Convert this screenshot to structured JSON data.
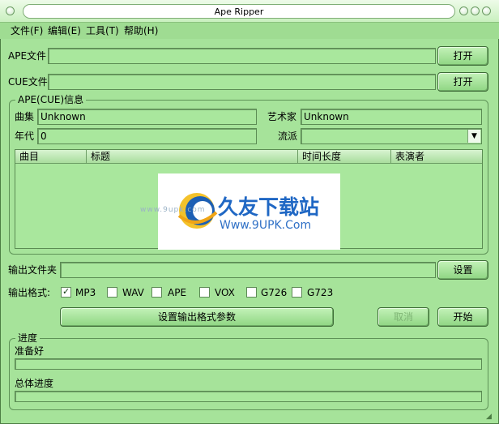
{
  "window": {
    "title": "Ape Ripper"
  },
  "menu": [
    {
      "label": "文件(F)"
    },
    {
      "label": "编辑(E)"
    },
    {
      "label": "工具(T)"
    },
    {
      "label": "帮助(H)"
    }
  ],
  "ape_file": {
    "label": "APE文件",
    "value": "",
    "open_label": "打开"
  },
  "cue_file": {
    "label": "CUE文件",
    "value": "",
    "open_label": "打开"
  },
  "info_group": {
    "title": "APE(CUE)信息",
    "album_label": "曲集",
    "album_value": "Unknown",
    "artist_label": "艺术家",
    "artist_value": "Unknown",
    "year_label": "年代",
    "year_value": "0",
    "genre_label": "流派",
    "genre_value": ""
  },
  "track_list": {
    "columns": [
      "曲目",
      "标题",
      "时间长度",
      "表演者"
    ],
    "rows": []
  },
  "watermark": {
    "brand": "久友下载站",
    "url": "Www.9UPK.Com",
    "small": "www.9upk.com"
  },
  "output": {
    "label": "输出文件夹",
    "value": "",
    "settings_label": "设置"
  },
  "format": {
    "label": "输出格式:",
    "options": [
      {
        "label": "MP3",
        "checked": true
      },
      {
        "label": "WAV",
        "checked": false
      },
      {
        "label": "APE",
        "checked": false
      },
      {
        "label": "VOX",
        "checked": false
      },
      {
        "label": "G726",
        "checked": false
      },
      {
        "label": "G723",
        "checked": false
      }
    ]
  },
  "actions": {
    "params_label": "设置输出格式参数",
    "cancel_label": "取消",
    "start_label": "开始"
  },
  "progress": {
    "group_title": "进度",
    "status_text": "准备好",
    "status_value": 0,
    "overall_label": "总体进度",
    "overall_value": 0
  }
}
